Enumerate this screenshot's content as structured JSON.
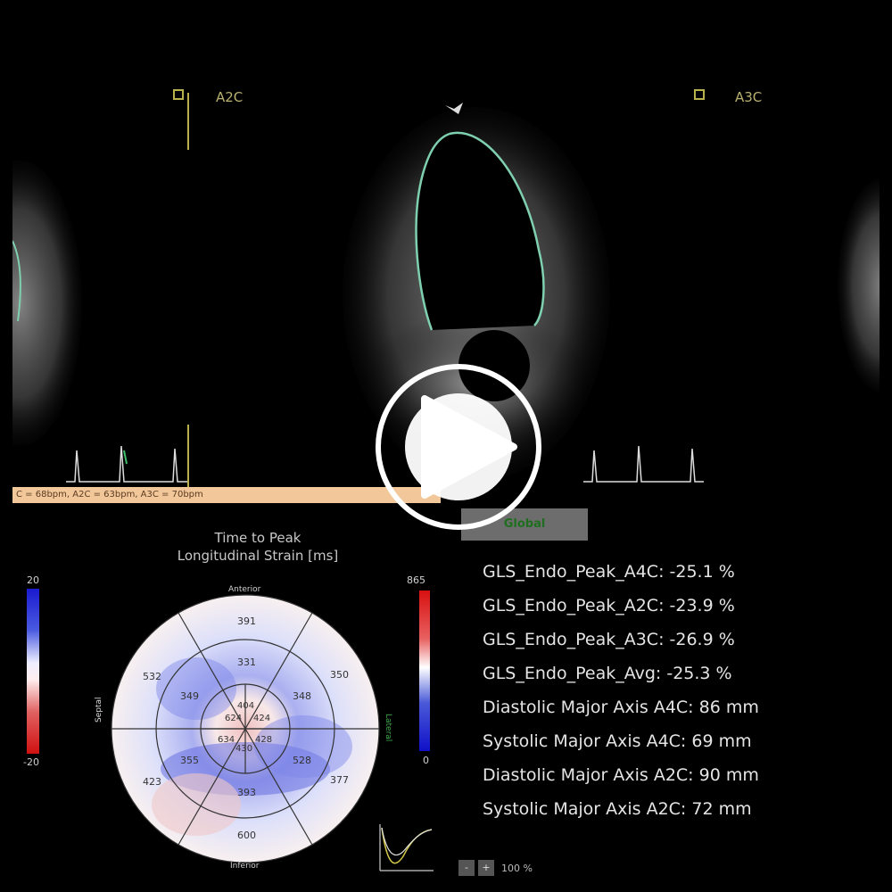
{
  "views": {
    "left_label": "A2C",
    "right_label": "A3C"
  },
  "heart_rate_bar": "C = 68bpm, A2C = 63bpm, A3C = 70bpm",
  "button": {
    "label": "Global"
  },
  "bullseye": {
    "title_line1": "Time to Peak",
    "title_line2": "Longitudinal Strain [ms]",
    "label_top": "Anterior",
    "label_bottom": "Inferior",
    "label_left": "Septal",
    "label_right": "Lateral",
    "segments": {
      "basal_ant": "391",
      "basal_antlat": "350",
      "basal_inflat": "377",
      "basal_inf": "600",
      "basal_infsep": "423",
      "basal_antsep": "532",
      "mid_ant": "331",
      "mid_antlat": "348",
      "mid_inflat": "528",
      "mid_inf": "393",
      "mid_infsep": "355",
      "mid_antsep": "349",
      "apex_ant": "404",
      "apex_lat": "424",
      "apex_inf": "428",
      "apex_sep": "634",
      "apex_center": "430",
      "apex_extra": "624"
    },
    "accent_green": "#0f5a1a"
  },
  "left_colorbar": {
    "top": "20",
    "bottom": "-20"
  },
  "right_colorbar": {
    "top": "865",
    "bottom": "0"
  },
  "metrics": [
    "GLS_Endo_Peak_A4C: -25.1 %",
    "GLS_Endo_Peak_A2C: -23.9 %",
    "GLS_Endo_Peak_A3C: -26.9 %",
    "GLS_Endo_Peak_Avg: -25.3 %",
    "Diastolic Major Axis A4C: 86 mm",
    "Systolic Major Axis A4C: 69 mm",
    "Diastolic Major Axis A2C: 90 mm",
    "Systolic Major Axis A2C: 72 mm"
  ],
  "zoom": {
    "minus": "-",
    "plus": "+",
    "level": "100 %"
  },
  "player": {
    "icon": "play-icon"
  }
}
